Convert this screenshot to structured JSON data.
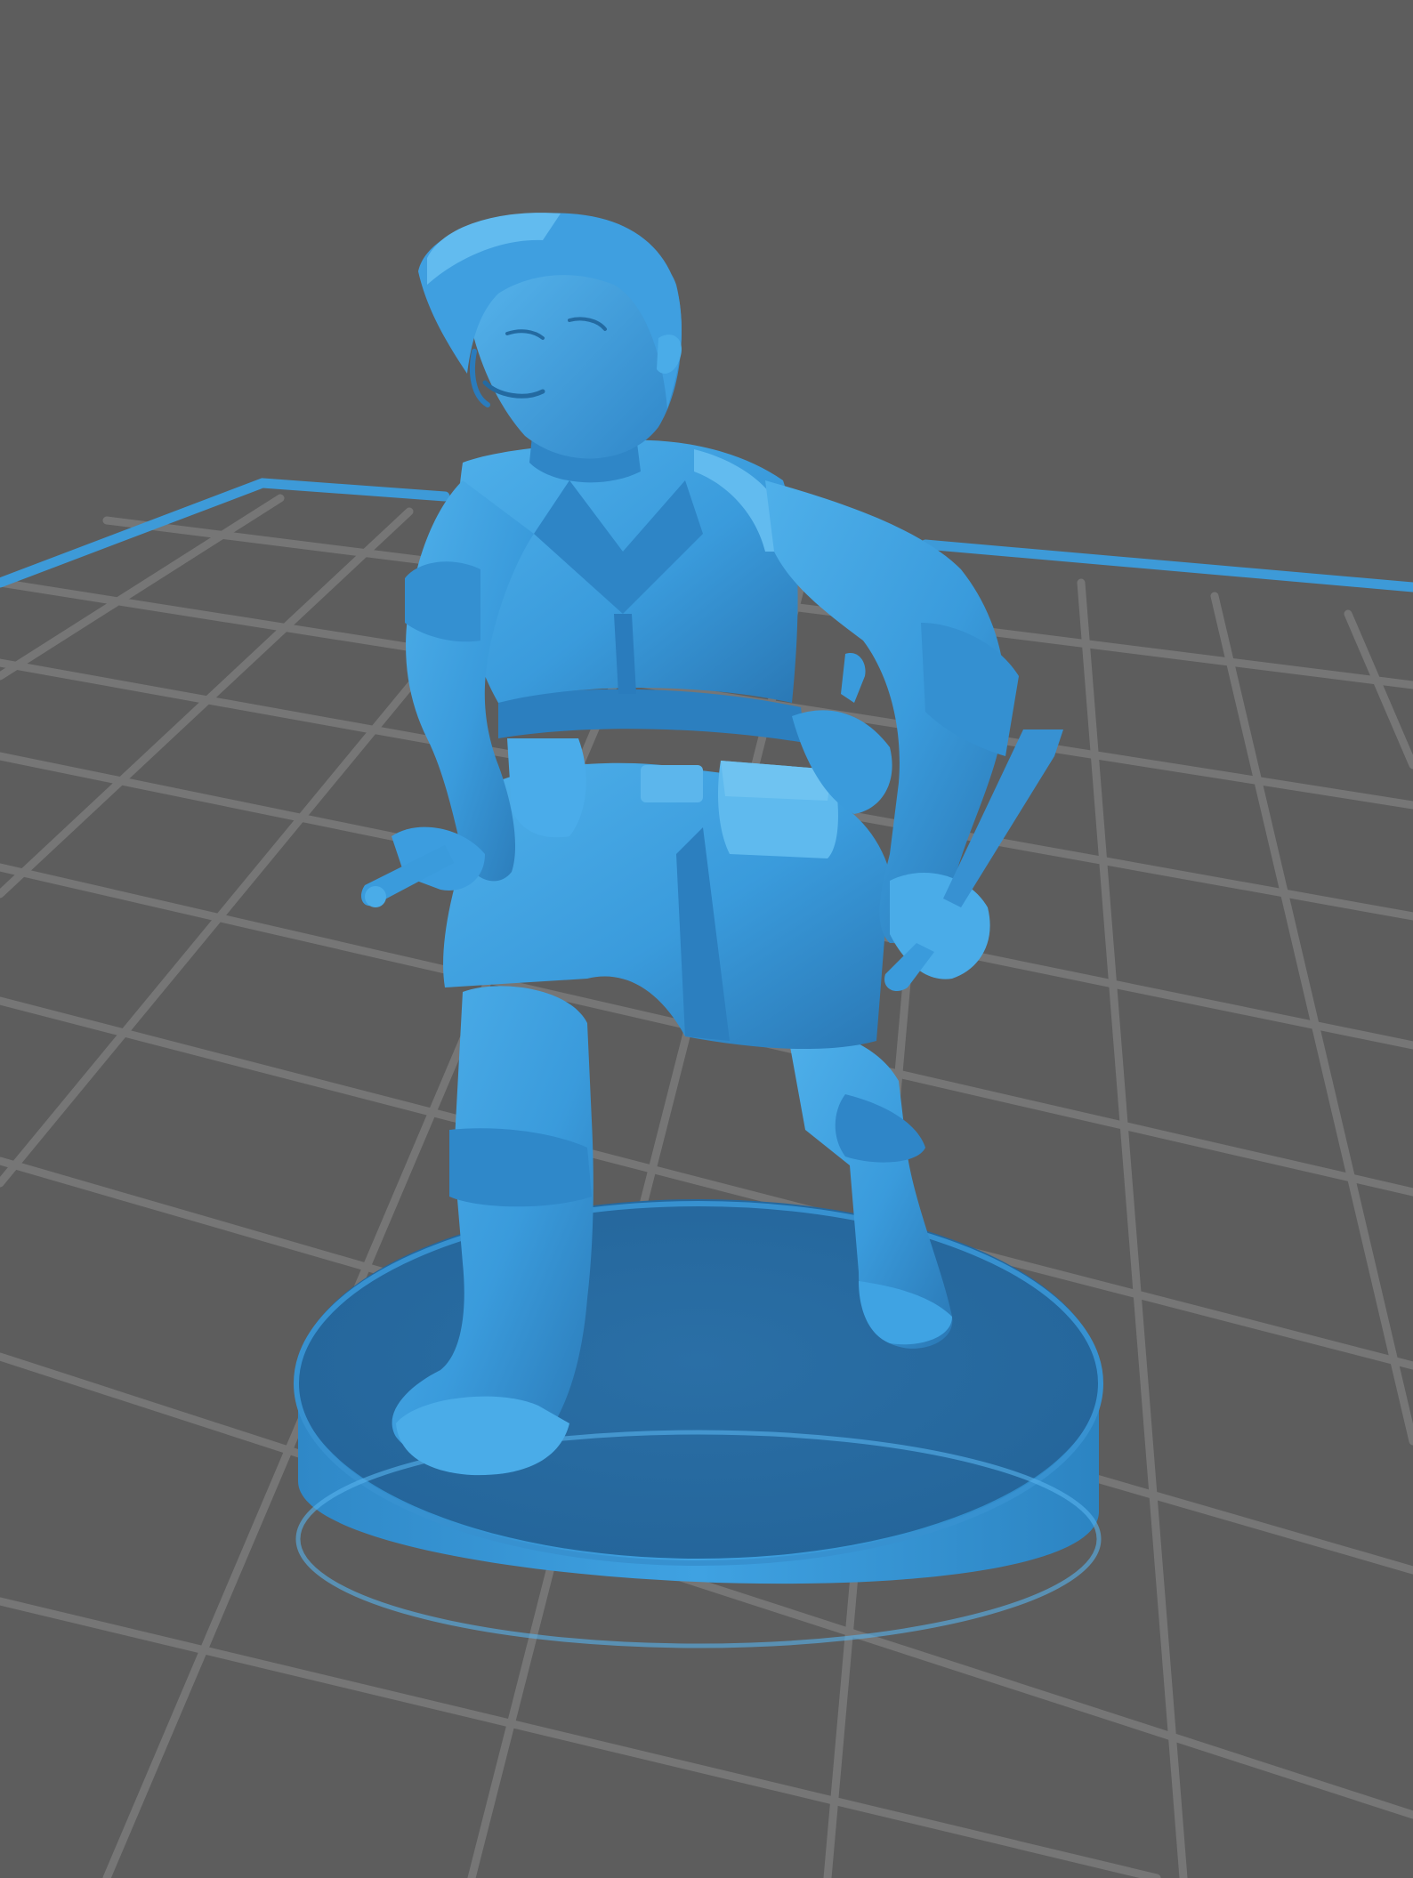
{
  "viewer": {
    "background_color": "#5d5d5d",
    "grid_line_color": "#767676",
    "plate_edge_color": "#3d9ad8",
    "model_color": "#3a9bdc",
    "model_shadow_color": "#24679b",
    "model_highlight_color": "#63b8ee",
    "model_name": ""
  }
}
